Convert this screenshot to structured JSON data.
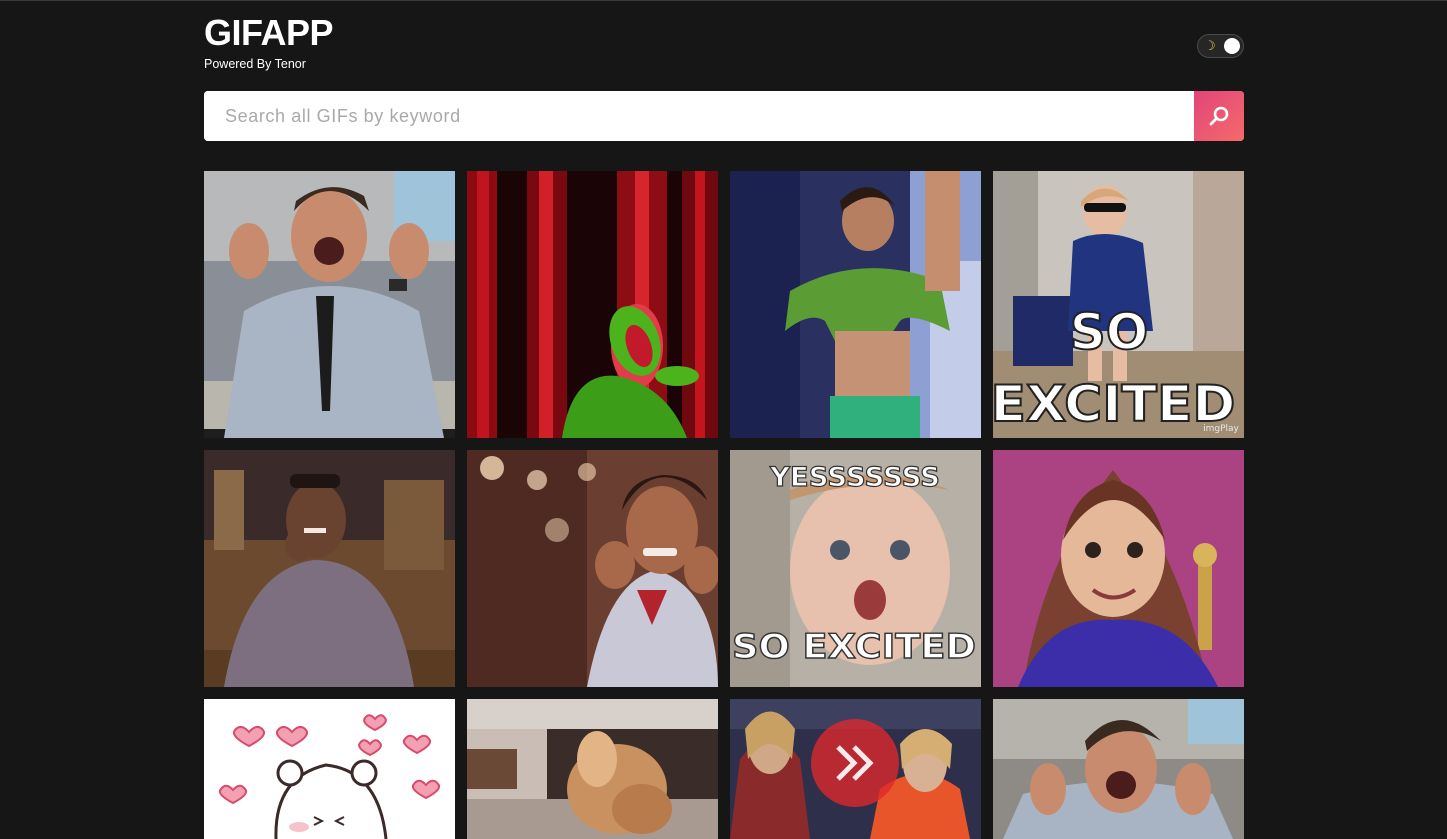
{
  "header": {
    "title": "GIFAPP",
    "subtitle": "Powered By Tenor"
  },
  "theme_toggle": {
    "icon": "moon-icon",
    "state": "dark"
  },
  "search": {
    "placeholder": "Search all GIFs by keyword",
    "value": "",
    "button_icon": "search-icon"
  },
  "colors": {
    "background": "#161616",
    "accent_start": "#e2457a",
    "accent_end": "#f56a6a"
  },
  "gifs": [
    {
      "subject": "man-laughing-shirt-tie",
      "caption": ""
    },
    {
      "subject": "kermit-frog-red-curtain",
      "caption": ""
    },
    {
      "subject": "boy-lifting-shirt-dancing",
      "caption": ""
    },
    {
      "subject": "toddler-sunglasses-dancing",
      "caption_top": "SO",
      "caption_bottom": "EXCITED",
      "watermark": "imgPlay"
    },
    {
      "subject": "man-laughing-talk-show",
      "caption": ""
    },
    {
      "subject": "girl-excited-fists",
      "caption": ""
    },
    {
      "subject": "baby-excited",
      "caption_top": "YESSSSSSS",
      "caption_bottom": "SO EXCITED"
    },
    {
      "subject": "girl-excited-face",
      "caption": ""
    },
    {
      "subject": "bear-hearts-cartoon",
      "caption": ""
    },
    {
      "subject": "dog-spinning",
      "caption": ""
    },
    {
      "subject": "women-dancing-hive-logo",
      "caption": ""
    },
    {
      "subject": "man-laughing-shirt-tie-2",
      "caption": ""
    }
  ]
}
